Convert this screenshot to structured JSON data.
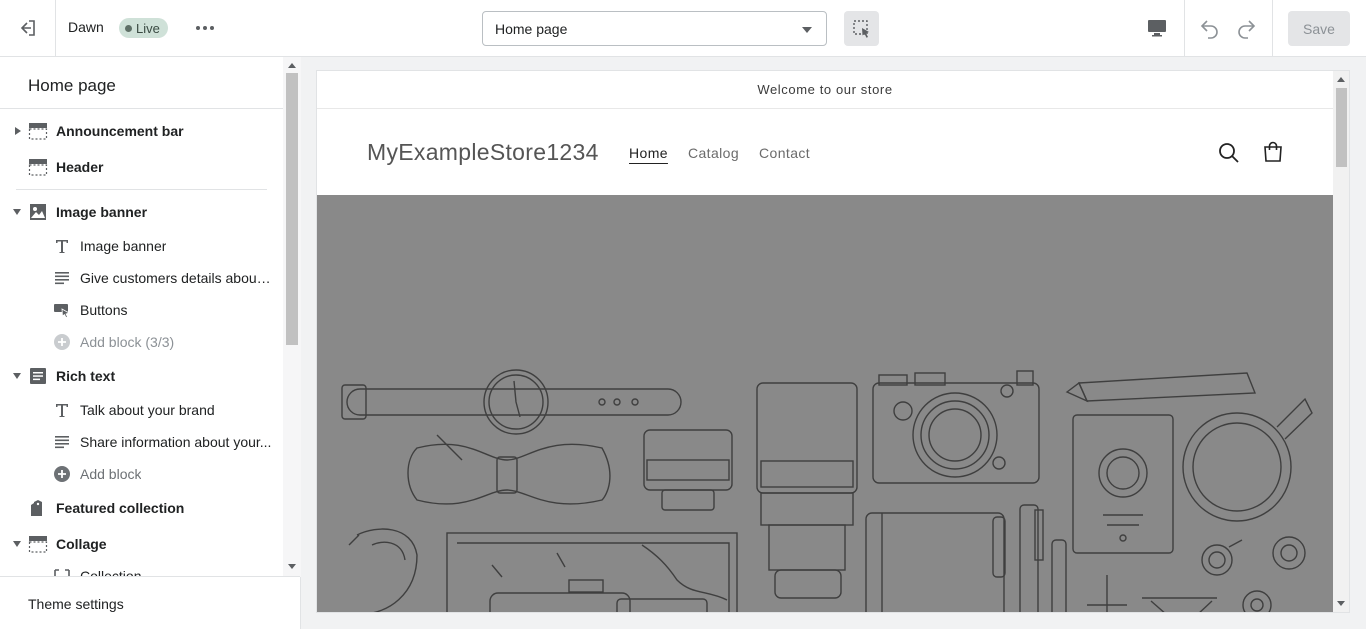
{
  "topbar": {
    "theme_name": "Dawn",
    "status_badge": "Live",
    "page_select": "Home page",
    "save_label": "Save"
  },
  "sidebar": {
    "title": "Home page",
    "sections": [
      {
        "label": "Announcement bar",
        "icon": "announcement-bar-icon",
        "arrow": "right"
      },
      {
        "label": "Header",
        "icon": "header-icon",
        "arrow": "none"
      },
      {
        "label": "Image banner",
        "icon": "image-icon",
        "arrow": "down"
      },
      {
        "label": "Rich text",
        "icon": "rich-text-icon",
        "arrow": "down"
      },
      {
        "label": "Featured collection",
        "icon": "collection-icon",
        "arrow": "none"
      },
      {
        "label": "Collage",
        "icon": "collage-icon",
        "arrow": "down"
      }
    ],
    "blocks": [
      {
        "label": "Image banner",
        "icon": "heading-icon"
      },
      {
        "label": "Give customers details about ...",
        "icon": "text-icon"
      },
      {
        "label": "Buttons",
        "icon": "button-icon"
      },
      {
        "label": "Add block (3/3)",
        "icon": "add-circle-icon"
      },
      {
        "label": "Talk about your brand",
        "icon": "heading-icon"
      },
      {
        "label": "Share information about your...",
        "icon": "text-icon"
      },
      {
        "label": "Add block",
        "icon": "add-circle-icon"
      },
      {
        "label": "Collection",
        "icon": "collection-block-icon"
      }
    ],
    "footer_label": "Theme settings"
  },
  "preview": {
    "announcement": "Welcome to our store",
    "store_name": "MyExampleStore1234",
    "nav": [
      "Home",
      "Catalog",
      "Contact"
    ],
    "active_nav": "Home",
    "banner_color": "#898989"
  }
}
